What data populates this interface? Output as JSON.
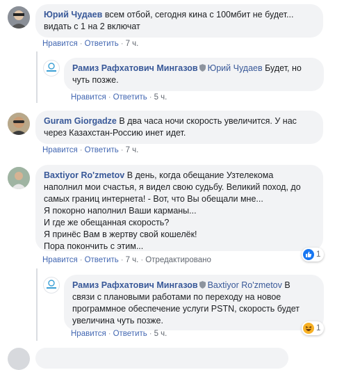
{
  "labels": {
    "like": "Нравится",
    "reply": "Ответить",
    "edited": "Отредактировано",
    "sep": "·"
  },
  "comments": [
    {
      "author": "Юрий Чудаев",
      "text": "всем отбой, сегодня кина с 100мбит не будет...\nвидать с 1 на 2 включат",
      "time": "7 ч."
    },
    {
      "author": "Рамиз Рафхатович Мингазов",
      "mention": "Юрий Чудаев",
      "text": "Будет, но\nчуть позже.",
      "time": "5 ч."
    },
    {
      "author": "Guram Giorgadze",
      "text": "В два часа ночи скорость увеличится. У нас\nчерез Казахстан-Россию инет идет.",
      "time": "7 ч."
    },
    {
      "author": "Baxtiyor Ro'zmetov",
      "text": "В день, когда обещание Узтелекома\nнаполнил мои счастья, я видел свою судьбу. Великий поход, до\nсамых границ интернета! - Вот, что Вы обещали мне...\nЯ покорно наполнил Ваши карманы...\nИ где же обещанная скорость?\nЯ принёс Вам в жертву свой кошелёк!\nПора покончить с этим...",
      "time": "7 ч.",
      "reaction_count": "1"
    },
    {
      "author": "Рамиз Рафхатович Мингазов",
      "mention": "Baxtiyor Ro'zmetov",
      "text": "В\nсвязи с плановыми работами по переходу на новое\nпрограммное обеспечение услуги PSTN, скорость будет\nувеличина чуть позже.",
      "time": "5 ч.",
      "reaction_count": "1"
    }
  ],
  "colors": {
    "link": "#385898",
    "action": "#4267b2",
    "bubble": "#f2f3f5",
    "like_blue": "#1877f2",
    "haha_yellow": "#f7b125"
  },
  "icons": [
    "page-shield-icon",
    "like-reaction-icon",
    "haha-reaction-icon",
    "uztelecom-logo-avatar"
  ]
}
